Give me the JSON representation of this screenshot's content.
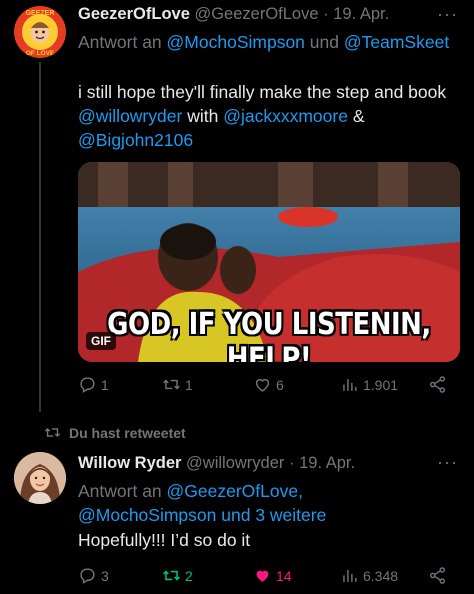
{
  "tweet1": {
    "name": "GeezerOfLove",
    "handle": "@GeezerOfLove",
    "dot": "·",
    "date": "19. Apr.",
    "more": "···",
    "reply_prefix": "Antwort an",
    "reply_user1": "@MochoSimpson",
    "reply_and": "und",
    "reply_user2": "@TeamSkeet",
    "text_part1": "i still hope they'll finally make the step and book",
    "mention1": "@willowryder",
    "text_with": "with",
    "mention2": "@jackxxxmoore",
    "text_amp": "&",
    "mention3": "@Bigjohn2106",
    "gif_caption": "GOD, IF YOU LISTENIN, HELP!",
    "gif_badge": "GIF",
    "replies": "1",
    "retweets": "1",
    "likes": "6",
    "views": "1.901"
  },
  "tweet2": {
    "retweeted_label": "Du hast retweetet",
    "name": "Willow Ryder",
    "handle": "@willowryder",
    "dot": "·",
    "date": "19. Apr.",
    "more": "···",
    "reply_prefix": "Antwort an",
    "reply_user1": "@GeezerOfLove,",
    "reply_user2": "@MochoSimpson",
    "reply_rest": "und 3 weitere",
    "text": "Hopefully!!! I’d so do it",
    "replies": "3",
    "retweets": "2",
    "likes": "14",
    "views": "6.348"
  },
  "avatar1_logo_text": "GEEZER OF LOVE",
  "colors": {
    "background": "#000000",
    "text": "#e7e9ea",
    "muted": "#71767b",
    "link": "#1d9bf0",
    "retweet_active": "#00ba7c",
    "like_active": "#f91880"
  }
}
